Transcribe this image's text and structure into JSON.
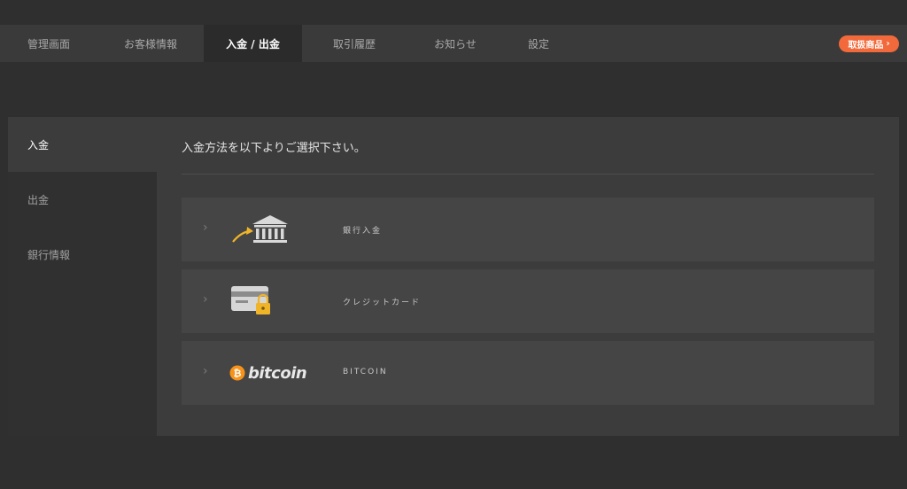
{
  "tabs": [
    {
      "label": "管理画面",
      "active": false
    },
    {
      "label": "お客様情報",
      "active": false
    },
    {
      "label": "入金 / 出金",
      "active": true
    },
    {
      "label": "取引履歴",
      "active": false
    },
    {
      "label": "お知らせ",
      "active": false
    },
    {
      "label": "設定",
      "active": false
    }
  ],
  "products_button": {
    "label": "取扱商品",
    "chevron": "›"
  },
  "sidebar": {
    "items": [
      {
        "label": "入金",
        "active": true
      },
      {
        "label": "出金",
        "active": false
      },
      {
        "label": "銀行情報",
        "active": false
      }
    ]
  },
  "main": {
    "heading": "入金方法を以下よりご選択下さい。",
    "methods": [
      {
        "label": "銀行入金",
        "icon": "bank-deposit-icon"
      },
      {
        "label": "クレジットカード",
        "icon": "credit-card-lock-icon"
      },
      {
        "label": "BITCOIN",
        "icon": "bitcoin-logo",
        "logo_text": "bitcoin"
      }
    ]
  },
  "colors": {
    "accent": "#f26a3b",
    "bitcoin": "#f7931a",
    "lock": "#f0b429"
  }
}
